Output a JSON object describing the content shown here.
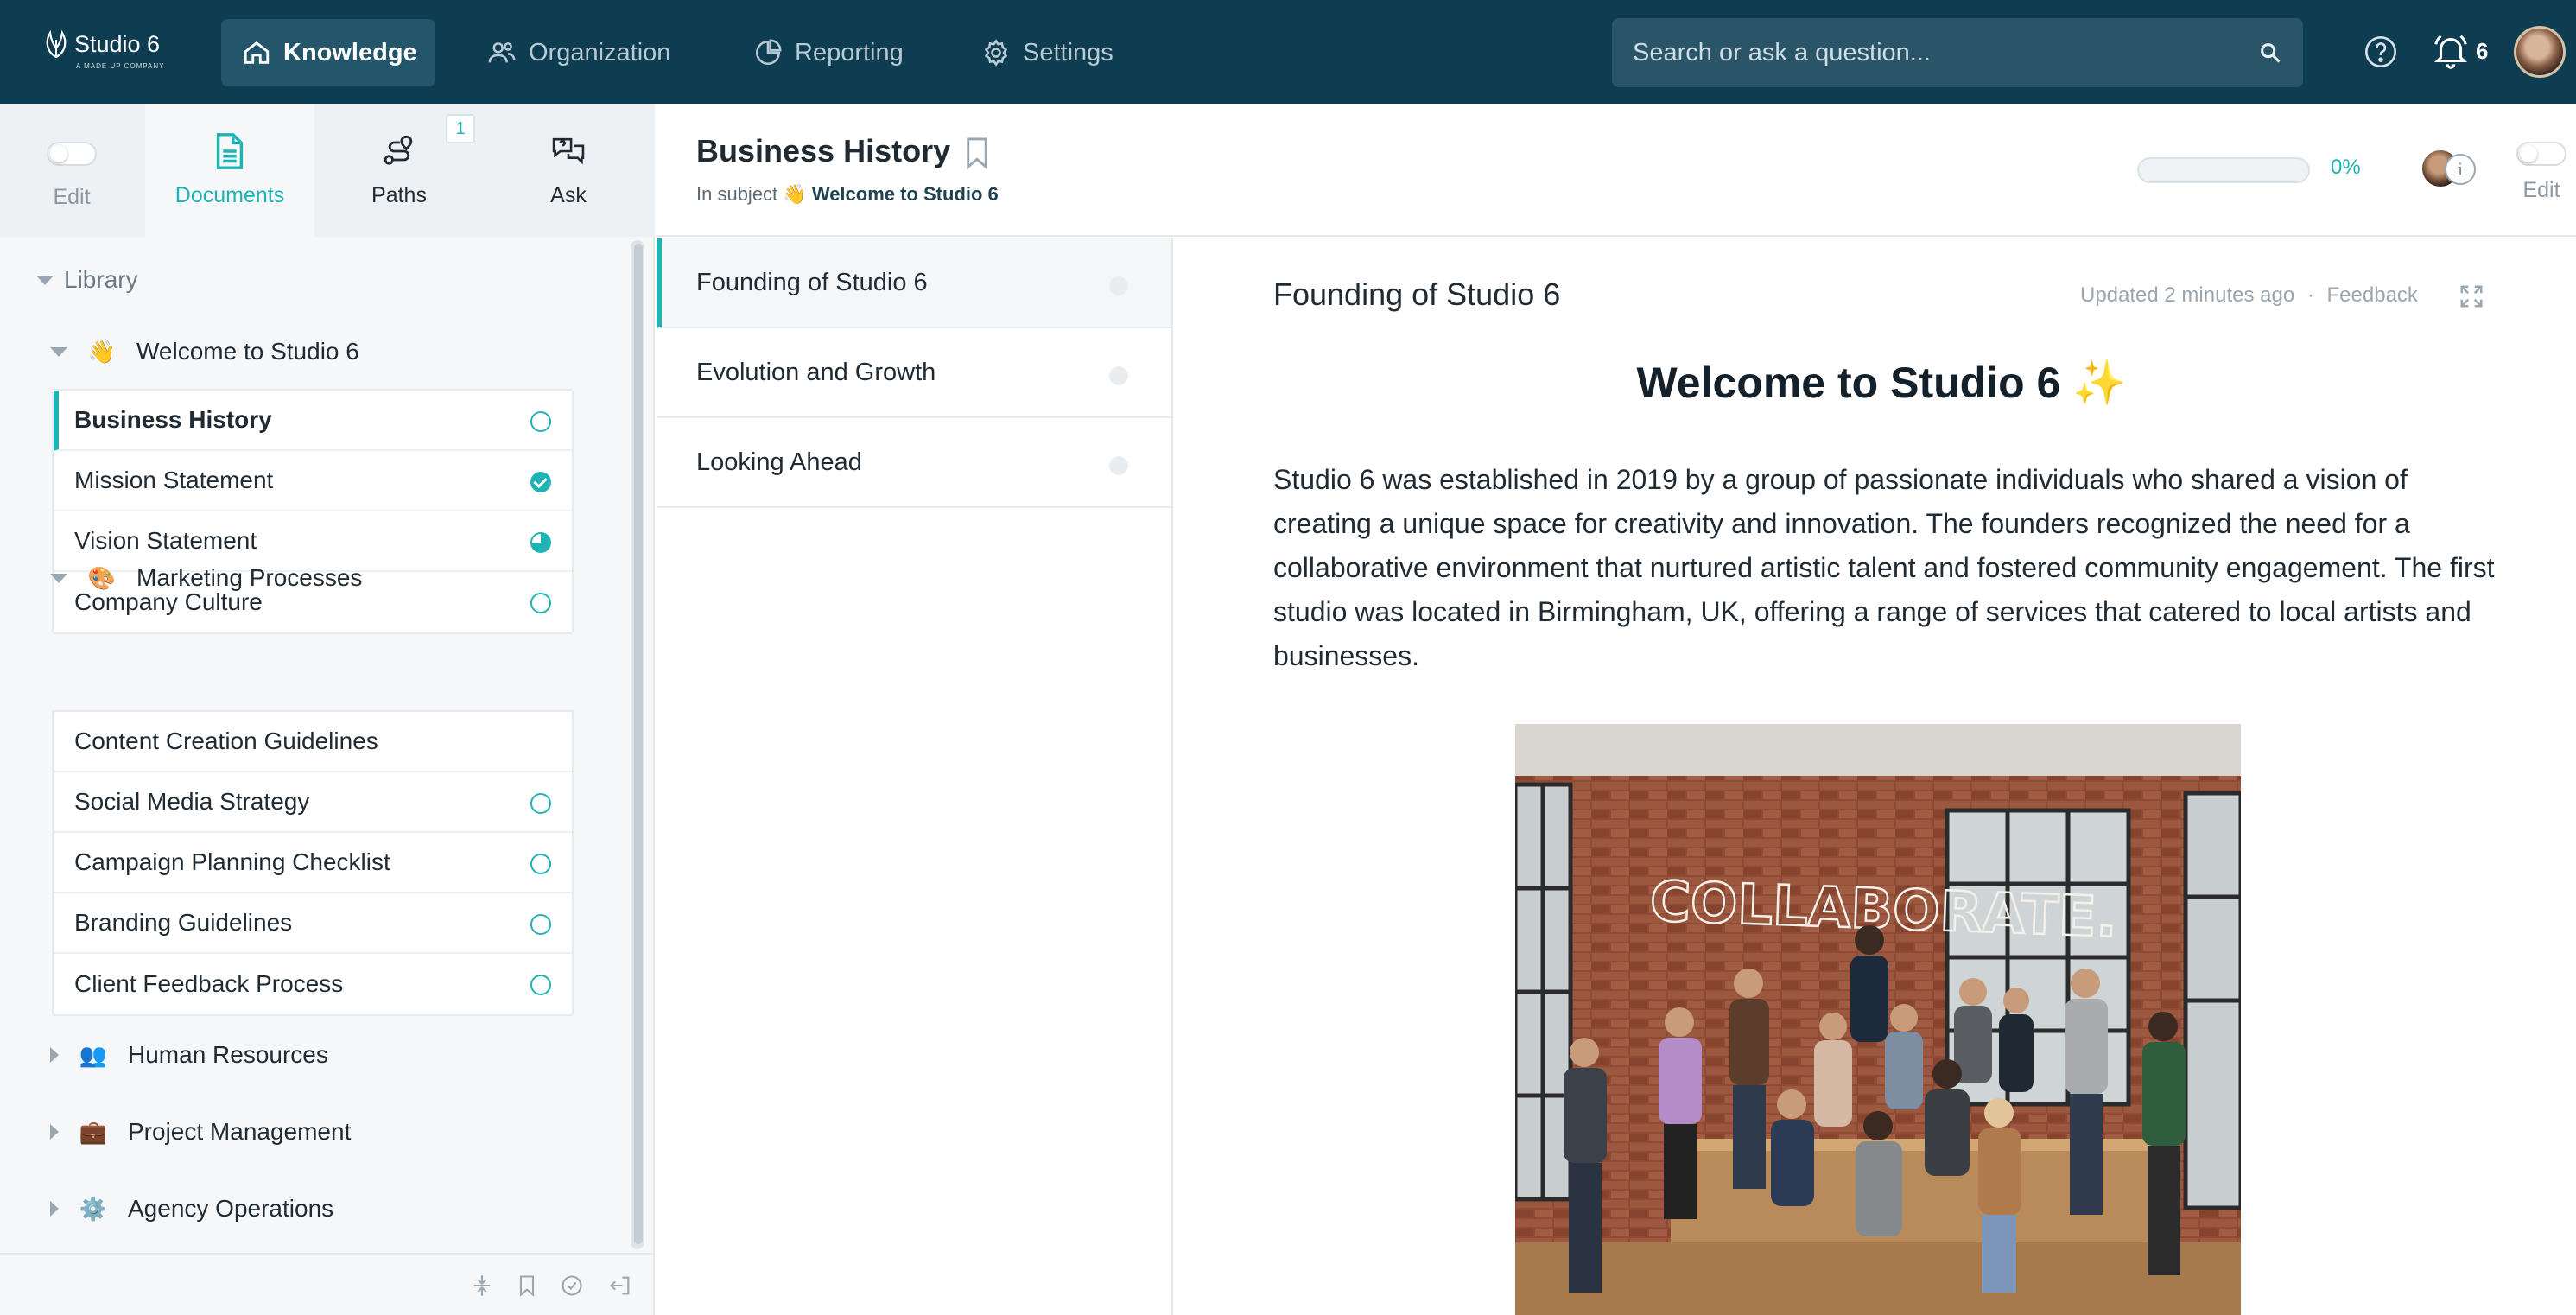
{
  "app": {
    "logo_name": "Studio 6",
    "logo_tagline": "A MADE UP COMPANY"
  },
  "nav": {
    "knowledge": "Knowledge",
    "organization": "Organization",
    "reporting": "Reporting",
    "settings": "Settings"
  },
  "search": {
    "placeholder": "Search or ask a question..."
  },
  "notifications": {
    "count": "6"
  },
  "sidebar": {
    "tabs": {
      "edit": "Edit",
      "documents": "Documents",
      "paths": "Paths",
      "paths_badge": "1",
      "ask": "Ask"
    },
    "library_label": "Library",
    "subjects": [
      {
        "emoji": "👋",
        "name": "Welcome to Studio 6",
        "docs": [
          "Business History",
          "Mission Statement",
          "Vision Statement",
          "Company Culture"
        ]
      },
      {
        "emoji": "🎨",
        "name": "Marketing Processes",
        "docs": [
          "Content Creation Guidelines",
          "Social Media Strategy",
          "Campaign Planning Checklist",
          "Branding Guidelines",
          "Client Feedback Process"
        ]
      },
      {
        "emoji": "👥",
        "name": "Human Resources"
      },
      {
        "emoji": "💼",
        "name": "Project Management"
      },
      {
        "emoji": "⚙️",
        "name": "Agency Operations"
      }
    ]
  },
  "doc_header": {
    "title": "Business History",
    "crumb_prefix": "In subject",
    "crumb_emoji": "👋",
    "crumb_subject": "Welcome to Studio 6",
    "progress_fraction": 0,
    "progress_label": "0%",
    "info_glyph": "i",
    "edit_label": "Edit"
  },
  "sections": [
    "Founding of Studio 6",
    "Evolution and Growth",
    "Looking Ahead"
  ],
  "content": {
    "section_title": "Founding of Studio 6",
    "updated": "Updated 2 minutes ago",
    "separator": "·",
    "feedback": "Feedback",
    "heading": "Welcome to Studio 6",
    "heading_sparkle": "✨",
    "paragraph": "Studio 6 was established in 2019 by a group of passionate individuals who shared a vision of creating a unique space for creativity and innovation. The founders recognized the need for a collaborative environment that nurtured artistic talent and fostered community engagement. The first studio was located in Birmingham, UK, offering a range of services that catered to local artists and businesses.",
    "photo_sign": "COLLABORATE."
  },
  "colors": {
    "topbar": "#0e3d52",
    "accent": "#1fb3b3",
    "nav_active": "#24566b"
  }
}
